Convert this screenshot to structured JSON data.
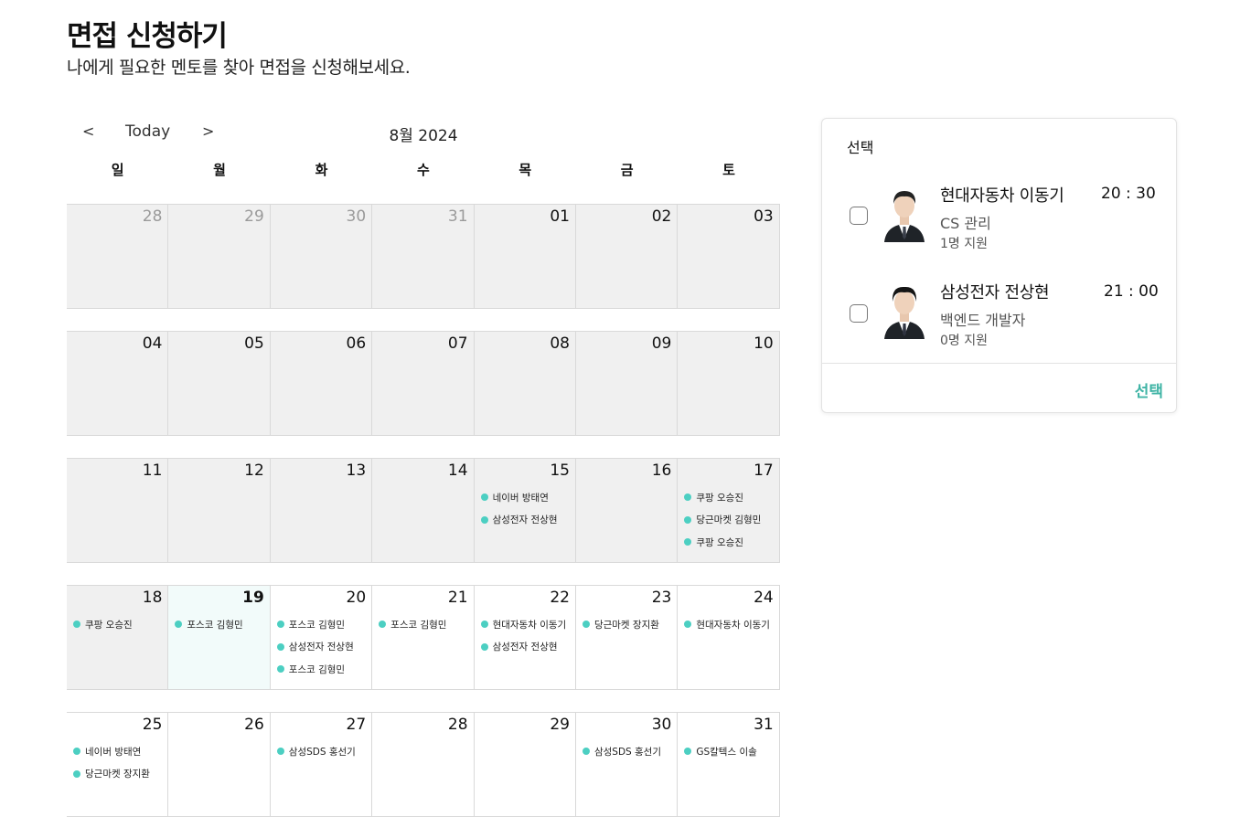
{
  "page": {
    "title": "면접 신청하기",
    "subtitle": "나에게 필요한 멘토를 찾아 면접을 신청해보세요."
  },
  "calendar": {
    "prev": "<",
    "today": "Today",
    "next": ">",
    "month": "8월 2024",
    "weekdays": [
      "일",
      "월",
      "화",
      "수",
      "목",
      "금",
      "토"
    ],
    "accent": "#4ccfc2",
    "weeks": [
      {
        "days": [
          {
            "num": "28",
            "dim": true,
            "events": []
          },
          {
            "num": "29",
            "dim": true,
            "events": []
          },
          {
            "num": "30",
            "dim": true,
            "events": []
          },
          {
            "num": "31",
            "dim": true,
            "events": []
          },
          {
            "num": "01",
            "events": []
          },
          {
            "num": "02",
            "events": []
          },
          {
            "num": "03",
            "events": []
          }
        ]
      },
      {
        "days": [
          {
            "num": "04",
            "events": []
          },
          {
            "num": "05",
            "events": []
          },
          {
            "num": "06",
            "events": []
          },
          {
            "num": "07",
            "events": []
          },
          {
            "num": "08",
            "events": []
          },
          {
            "num": "09",
            "events": []
          },
          {
            "num": "10",
            "events": []
          }
        ]
      },
      {
        "days": [
          {
            "num": "11",
            "events": []
          },
          {
            "num": "12",
            "events": []
          },
          {
            "num": "13",
            "events": []
          },
          {
            "num": "14",
            "events": []
          },
          {
            "num": "15",
            "events": [
              "네이버 방태연",
              "삼성전자 전상현"
            ]
          },
          {
            "num": "16",
            "events": []
          },
          {
            "num": "17",
            "events": [
              "쿠팡 오승진",
              "당근마켓 김형민",
              "쿠팡 오승진"
            ]
          }
        ]
      },
      {
        "days": [
          {
            "num": "18",
            "events": [
              "쿠팡 오승진"
            ]
          },
          {
            "num": "19",
            "today": true,
            "events": [
              "포스코 김형민"
            ]
          },
          {
            "num": "20",
            "white": true,
            "events": [
              "포스코 김형민",
              "삼성전자 전상현",
              "포스코 김형민"
            ]
          },
          {
            "num": "21",
            "white": true,
            "events": [
              "포스코 김형민"
            ]
          },
          {
            "num": "22",
            "white": true,
            "events": [
              "현대자동차 이동기",
              "삼성전자 전상현"
            ]
          },
          {
            "num": "23",
            "white": true,
            "events": [
              "당근마켓 장지환"
            ]
          },
          {
            "num": "24",
            "white": true,
            "events": [
              "현대자동차 이동기"
            ]
          }
        ]
      },
      {
        "days": [
          {
            "num": "25",
            "white": true,
            "events": [
              "네이버 방태연",
              "당근마켓 장지환"
            ]
          },
          {
            "num": "26",
            "white": true,
            "events": []
          },
          {
            "num": "27",
            "white": true,
            "events": [
              "삼성SDS 홍선기"
            ]
          },
          {
            "num": "28",
            "white": true,
            "events": []
          },
          {
            "num": "29",
            "white": true,
            "events": []
          },
          {
            "num": "30",
            "white": true,
            "events": [
              "삼성SDS 홍선기"
            ]
          },
          {
            "num": "31",
            "white": true,
            "events": [
              "GS칼텍스 이솔"
            ]
          }
        ]
      }
    ]
  },
  "panel": {
    "title": "선택",
    "select_label": "선택",
    "select_color": "#3fb4a5",
    "mentors": [
      {
        "name": "현대자동차 이동기",
        "time": "20 : 30",
        "role": "CS 관리",
        "count": "1명 지원"
      },
      {
        "name": "삼성전자 전상현",
        "time": "21 : 00",
        "role": "백엔드 개발자",
        "count": "0명 지원"
      }
    ]
  }
}
